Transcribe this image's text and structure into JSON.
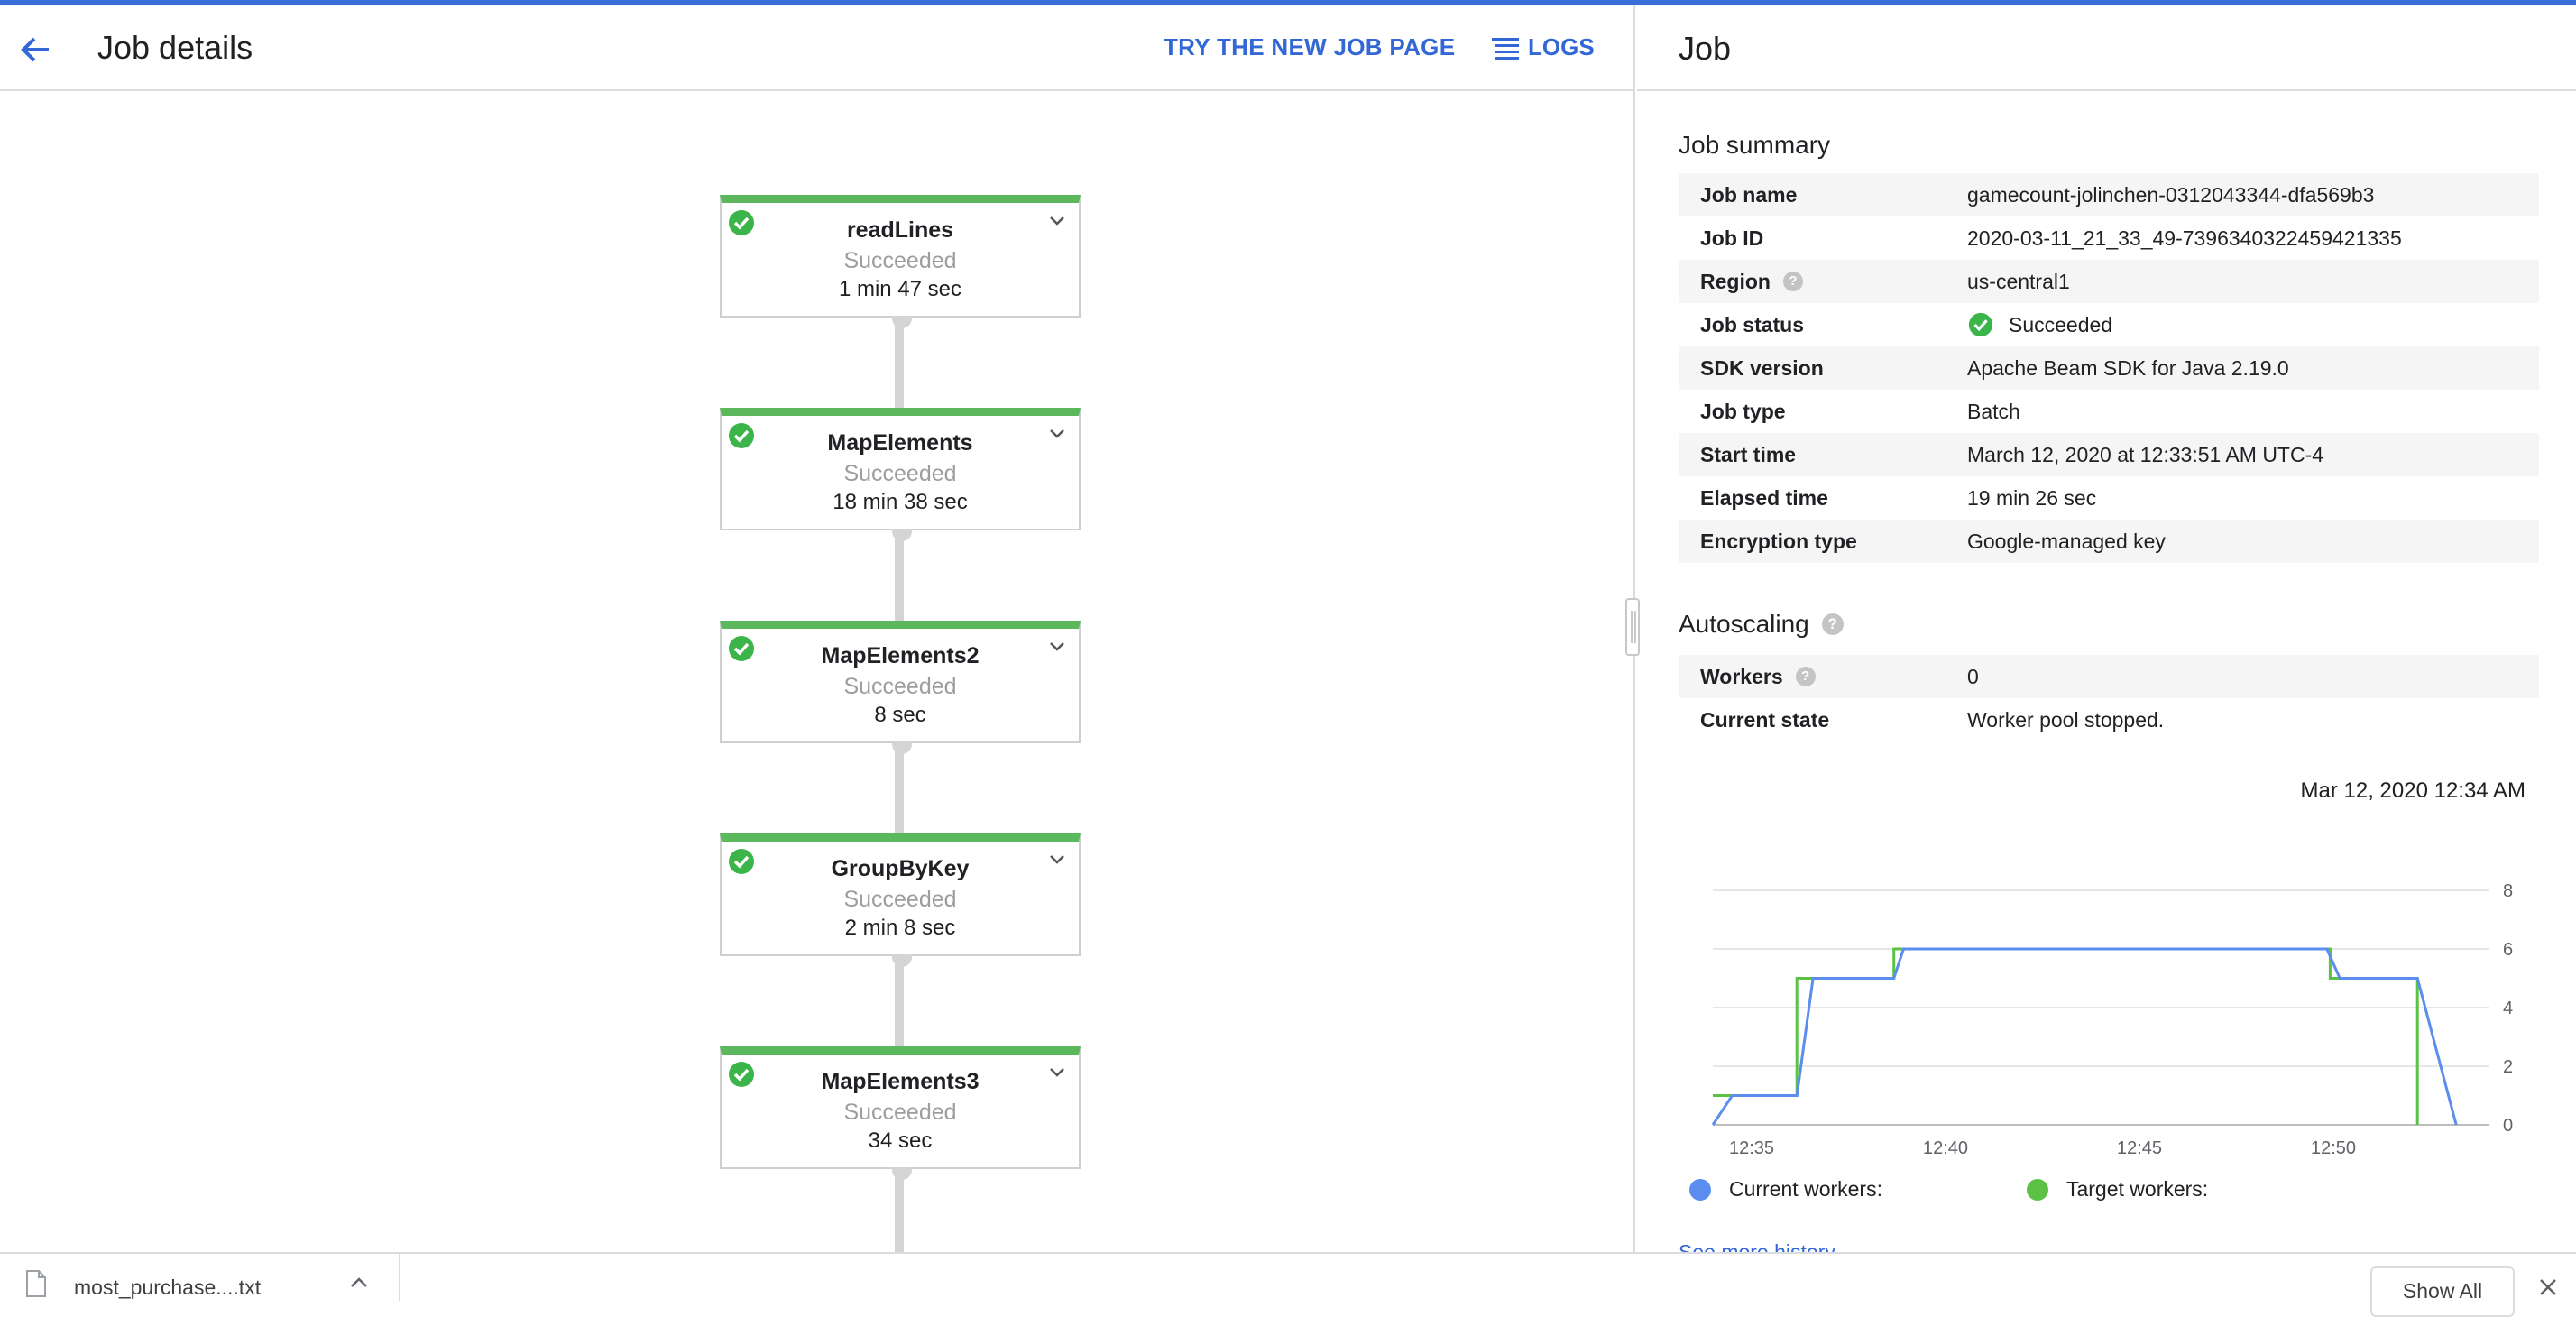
{
  "header": {
    "title": "Job details",
    "try_new_label": "TRY THE NEW JOB PAGE",
    "logs_label": "LOGS"
  },
  "graph": {
    "steps": [
      {
        "name": "readLines",
        "status": "Succeeded",
        "duration": "1 min 47 sec"
      },
      {
        "name": "MapElements",
        "status": "Succeeded",
        "duration": "18 min 38 sec"
      },
      {
        "name": "MapElements2",
        "status": "Succeeded",
        "duration": "8 sec"
      },
      {
        "name": "GroupByKey",
        "status": "Succeeded",
        "duration": "2 min 8 sec"
      },
      {
        "name": "MapElements3",
        "status": "Succeeded",
        "duration": "34 sec"
      }
    ]
  },
  "panel": {
    "title": "Job",
    "summary_title": "Job summary",
    "summary": [
      {
        "key": "Job name",
        "value": "gamecount-jolinchen-0312043344-dfa569b3"
      },
      {
        "key": "Job ID",
        "value": "2020-03-11_21_33_49-7396340322459421335"
      },
      {
        "key": "Region",
        "value": "us-central1"
      },
      {
        "key": "Job status",
        "value": "Succeeded"
      },
      {
        "key": "SDK version",
        "value": "Apache Beam SDK for Java 2.19.0"
      },
      {
        "key": "Job type",
        "value": "Batch"
      },
      {
        "key": "Start time",
        "value": "March 12, 2020 at 12:33:51 AM UTC-4"
      },
      {
        "key": "Elapsed time",
        "value": "19 min 26 sec"
      },
      {
        "key": "Encryption type",
        "value": "Google-managed key"
      }
    ],
    "autoscaling_title": "Autoscaling",
    "autoscaling": [
      {
        "key": "Workers",
        "value": "0"
      },
      {
        "key": "Current state",
        "value": "Worker pool stopped."
      }
    ],
    "chart_timestamp": "Mar 12, 2020 12:34 AM",
    "legend_current": "Current workers:",
    "legend_target": "Target workers:",
    "more_history": "See more history",
    "colors": {
      "current": "#5b8def",
      "target": "#5cc246"
    }
  },
  "chart_data": {
    "type": "line",
    "x_ticks": [
      "12:35",
      "12:40",
      "12:45",
      "12:50"
    ],
    "y_ticks": [
      0,
      2,
      4,
      6,
      8
    ],
    "ylim": [
      0,
      8
    ],
    "xlim": [
      "12:34",
      "12:54"
    ],
    "grid": true,
    "legend_position": "bottom",
    "series": [
      {
        "name": "Current workers:",
        "color": "#5b8def",
        "points": [
          [
            "12:34:00",
            0
          ],
          [
            "12:34:30",
            1
          ],
          [
            "12:36:10",
            1
          ],
          [
            "12:36:35",
            5
          ],
          [
            "12:38:40",
            5
          ],
          [
            "12:38:55",
            6
          ],
          [
            "12:49:50",
            6
          ],
          [
            "12:50:10",
            5
          ],
          [
            "12:52:10",
            5
          ],
          [
            "12:53:10",
            0
          ]
        ]
      },
      {
        "name": "Target workers:",
        "color": "#5cc246",
        "points": [
          [
            "12:34:00",
            1
          ],
          [
            "12:36:10",
            1
          ],
          [
            "12:36:10",
            5
          ],
          [
            "12:38:40",
            5
          ],
          [
            "12:38:40",
            6
          ],
          [
            "12:49:55",
            6
          ],
          [
            "12:49:55",
            5
          ],
          [
            "12:52:10",
            5
          ],
          [
            "12:52:10",
            0
          ]
        ]
      }
    ]
  },
  "download_bar": {
    "file_name": "most_purchase....txt",
    "show_all_label": "Show All"
  }
}
